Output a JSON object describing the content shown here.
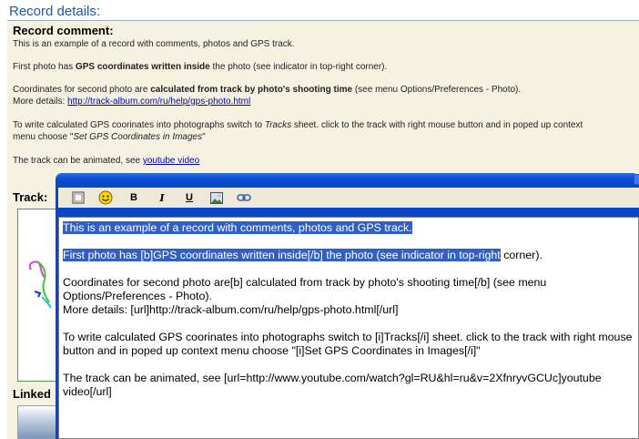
{
  "header": {
    "title": "Record details:"
  },
  "record_comment": {
    "title": "Record comment:",
    "line1": "This is an example of a record with comments, photos and GPS track.",
    "line2_pre": "First photo has ",
    "line2_bold": "GPS coordinates written inside",
    "line2_post": " the photo (see indicator in top-right corner).",
    "line3_pre": "Coordinates for second photo are ",
    "line3_bold": "calculated from track by photo's shooting time",
    "line3_post": " (see menu Options/Preferences - Photo).",
    "line4_pre": "More details: ",
    "line4_link": "http://track-album.com/ru/help/gps-photo.html",
    "line5_pre": "To write calculated GPS coorinates into photographs switch to ",
    "line5_italic": "Tracks",
    "line5_post": " sheet. click to the track with right mouse button and in poped up context",
    "line6_pre": "menu choose \"",
    "line6_italic": "Set GPS Coordinates in Images",
    "line6_post": "\"",
    "line7_pre": "The track can be animated, see ",
    "line7_link": "youtube video"
  },
  "track": {
    "label": "Track:"
  },
  "linked": {
    "label": "Linked"
  },
  "toolbar": {
    "source_icon": "source-icon",
    "smiley_icon": "smiley-icon",
    "bold_label": "B",
    "italic_label": "I",
    "underline_label": "U",
    "image_icon": "image-icon",
    "link_icon": "link-icon"
  },
  "editor": {
    "p1": "This is an example of a record with comments, photos and GPS track.",
    "p2_selected": "First photo has [b]GPS coordinates written inside[/b] the photo (see indicator in top-right",
    "p2_rest": " corner).",
    "p3": "Coordinates for second photo are[b] calculated from track by photo's shooting time[/b] (see menu Options/Preferences - Photo).\nMore details: [url]http://track-album.com/ru/help/gps-photo.html[/url]",
    "p4": "To write calculated GPS coorinates into photographs switch to [i]Tracks[/i] sheet. click to the track with right mouse button and in poped up context menu choose \"[i]Set GPS Coordinates in Images[/i]\"",
    "p5": "The track can be animated, see [url=http://www.youtube.com/watch?gl=RU&hl=ru&v=2XfnryvGCUc]youtube video[/url]"
  },
  "colors": {
    "header_text": "#1b5aa6",
    "panel_bg": "#f5f2e2",
    "titlebar": "#0a4fd4",
    "selection": "#3160c4",
    "toolbar_bg": "#ece9d8"
  }
}
